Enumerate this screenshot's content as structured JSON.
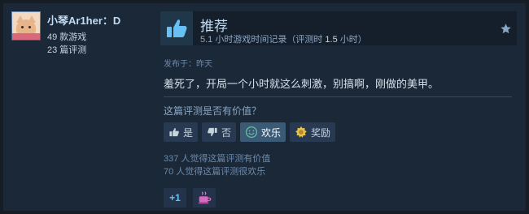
{
  "author": {
    "name": "小琴Ar1her：D",
    "games_owned": "49",
    "games_owned_suffix": " 款游戏",
    "reviews": "23",
    "reviews_suffix": " 篇评测"
  },
  "recommendation": {
    "title": "推荐",
    "hours_total": "5.1",
    "hours_text_1": " 小时游戏时间记录（评测时 ",
    "hours_at_review": "1.5",
    "hours_text_2": " 小时）"
  },
  "post": {
    "date": "发布于：昨天",
    "text": "羞死了，开局一个小时就这么刺激，别搞啊，刚做的美甲。"
  },
  "helpful": {
    "question": "这篇评测是否有价值？",
    "yes_label": "是",
    "no_label": "否",
    "funny_label": "欢乐",
    "award_label": "奖励",
    "helpful_count_text": "337 人觉得这篇评测有价值",
    "funny_count_text": "70 人觉得这篇评测很欢乐"
  },
  "awards": [
    {
      "icon": "plus-one-icon",
      "label": "+1"
    },
    {
      "icon": "coffee-cup-icon",
      "label": ""
    }
  ],
  "colors": {
    "background": "#171d25",
    "card": "#1b2838",
    "accent": "#67c1f5",
    "text": "#c6d4df"
  }
}
